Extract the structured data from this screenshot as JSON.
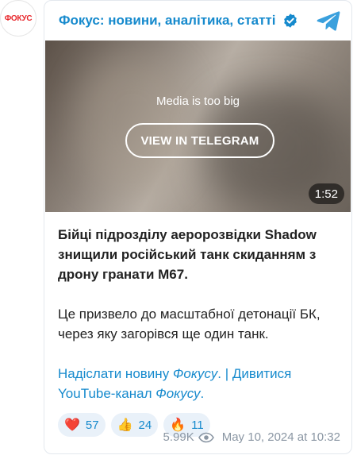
{
  "avatar": {
    "text": "ФОКУС",
    "accent": "#e8262b"
  },
  "channel": {
    "title": "Фокус: новини, аналітика, статті",
    "verified_icon": "verified-badge-icon",
    "telegram_icon": "telegram-plane-icon",
    "accent": "#168acd"
  },
  "media": {
    "message": "Media is too big",
    "button_label": "VIEW IN TELEGRAM",
    "duration": "1:52"
  },
  "post": {
    "lead": "Бійці підрозділу аеророзвідки Shadow знищили російський танк скиданням з дрону гранати М67.",
    "paragraph": "Це призвело до масштабної детонації БК, через яку загорівся ще один танк.",
    "link1_prefix": "Надіслати новину ",
    "link1_italic": "Фокусу",
    "link1_suffix": ".",
    "separator": " | ",
    "link2_prefix": "Дивитися YouTube-канал ",
    "link2_italic": "Фокусу",
    "link2_suffix": "."
  },
  "reactions": [
    {
      "emoji": "❤️",
      "icon": "heart-icon",
      "count": "57"
    },
    {
      "emoji": "👍",
      "icon": "thumbs-up-icon",
      "count": "24"
    },
    {
      "emoji": "🔥",
      "icon": "fire-icon",
      "count": "11"
    }
  ],
  "meta": {
    "views": "5.99K",
    "views_icon": "eye-icon",
    "timestamp": "May 10, 2024 at 10:32"
  }
}
